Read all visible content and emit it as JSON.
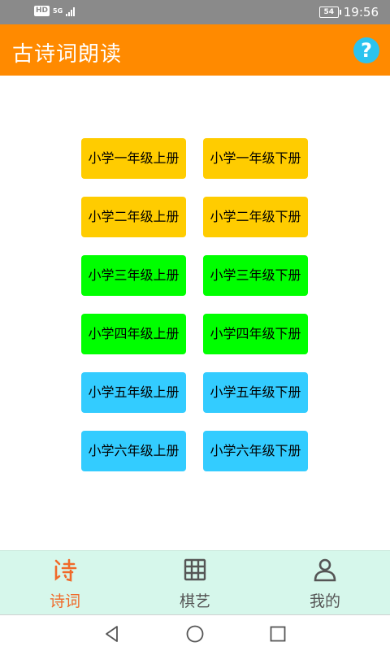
{
  "status_bar": {
    "hd": "HD",
    "network": "5G",
    "battery": "54",
    "time": "19:56"
  },
  "app_bar": {
    "title": "古诗词朗读",
    "help_label": "?",
    "color": "#ff8a00"
  },
  "grades": [
    {
      "label": "小学一年级上册",
      "color": "#ffcc00"
    },
    {
      "label": "小学一年级下册",
      "color": "#ffcc00"
    },
    {
      "label": "小学二年级上册",
      "color": "#ffcc00"
    },
    {
      "label": "小学二年级下册",
      "color": "#ffcc00"
    },
    {
      "label": "小学三年级上册",
      "color": "#00ff00"
    },
    {
      "label": "小学三年级下册",
      "color": "#00ff00"
    },
    {
      "label": "小学四年级上册",
      "color": "#00ff00"
    },
    {
      "label": "小学四年级下册",
      "color": "#00ff00"
    },
    {
      "label": "小学五年级上册",
      "color": "#33ccff"
    },
    {
      "label": "小学五年级下册",
      "color": "#33ccff"
    },
    {
      "label": "小学六年级上册",
      "color": "#33ccff"
    },
    {
      "label": "小学六年级下册",
      "color": "#33ccff"
    }
  ],
  "bottom_nav": {
    "items": [
      {
        "label": "诗词",
        "icon": "poem-icon",
        "active": true
      },
      {
        "label": "棋艺",
        "icon": "chess-grid-icon",
        "active": false
      },
      {
        "label": "我的",
        "icon": "person-icon",
        "active": false
      }
    ],
    "active_color": "#f06a2a",
    "inactive_color": "#555555"
  }
}
